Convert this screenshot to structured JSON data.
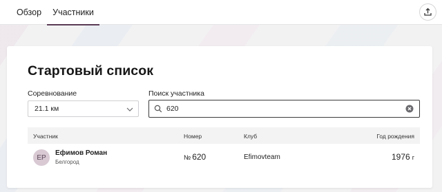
{
  "tabs": [
    {
      "label": "Обзор",
      "active": false
    },
    {
      "label": "Участники",
      "active": true
    }
  ],
  "header": {
    "export_icon": "upload-icon"
  },
  "card": {
    "title": "Стартовый список",
    "competition": {
      "label": "Соревнование",
      "selected": "21.1 км",
      "chevron_icon": "chevron-down-icon"
    },
    "search": {
      "label": "Поиск участника",
      "value": "620",
      "search_icon": "search-icon",
      "clear_icon": "clear-icon"
    },
    "table": {
      "columns": [
        "Участник",
        "Номер",
        "Клуб",
        "Год рождения"
      ],
      "rows": [
        {
          "initials": "ЕР",
          "name": "Ефимов Роман",
          "city": "Белгород",
          "number_symbol": "№",
          "number": "620",
          "club": "Efimovteam",
          "birth_year": "1976",
          "birth_unit": "г"
        }
      ]
    }
  },
  "colors": {
    "accent": "#5a3a54",
    "avatar_bg": "#d8c9d3",
    "header_bg": "#f3f3f4"
  }
}
